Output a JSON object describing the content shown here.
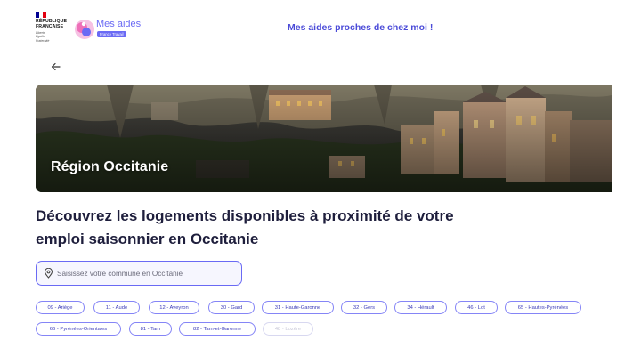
{
  "header": {
    "gov_lines": [
      "RÉPUBLIQUE",
      "FRANÇAISE"
    ],
    "gov_motto": [
      "Liberté",
      "Égalité",
      "Fraternité"
    ],
    "brand_name": "Mes aides",
    "brand_tag": "France Travail",
    "nav_link": "Mes aides proches de chez moi !"
  },
  "hero": {
    "title": "Région Occitanie",
    "image": "rocamadour-cliff-village-photo"
  },
  "main": {
    "headline_line1": "Découvrez les logements disponibles à proximité de votre",
    "headline_line2": "emploi saisonnier en Occitanie"
  },
  "search": {
    "placeholder": "Saisissez votre commune en Occitanie",
    "value": "",
    "icon": "location-pin-icon"
  },
  "departments": [
    {
      "label": "09 - Ariège",
      "enabled": true
    },
    {
      "label": "11 - Aude",
      "enabled": true
    },
    {
      "label": "12 - Aveyron",
      "enabled": true
    },
    {
      "label": "30 - Gard",
      "enabled": true
    },
    {
      "label": "31 - Haute-Garonne",
      "enabled": true
    },
    {
      "label": "32 - Gers",
      "enabled": true
    },
    {
      "label": "34 - Hérault",
      "enabled": true
    },
    {
      "label": "46 - Lot",
      "enabled": true
    },
    {
      "label": "65 - Hautes-Pyrénées",
      "enabled": true
    },
    {
      "label": "66 - Pyrénées-Orientales",
      "enabled": true
    },
    {
      "label": "81 - Tarn",
      "enabled": true
    },
    {
      "label": "82 - Tarn-et-Garonne",
      "enabled": true
    },
    {
      "label": "48 - Lozère",
      "enabled": false
    }
  ],
  "colors": {
    "accent": "#6a6af4",
    "link": "#4b4bd8",
    "text": "#1e1e3c",
    "chip_border": "#8585f6"
  }
}
